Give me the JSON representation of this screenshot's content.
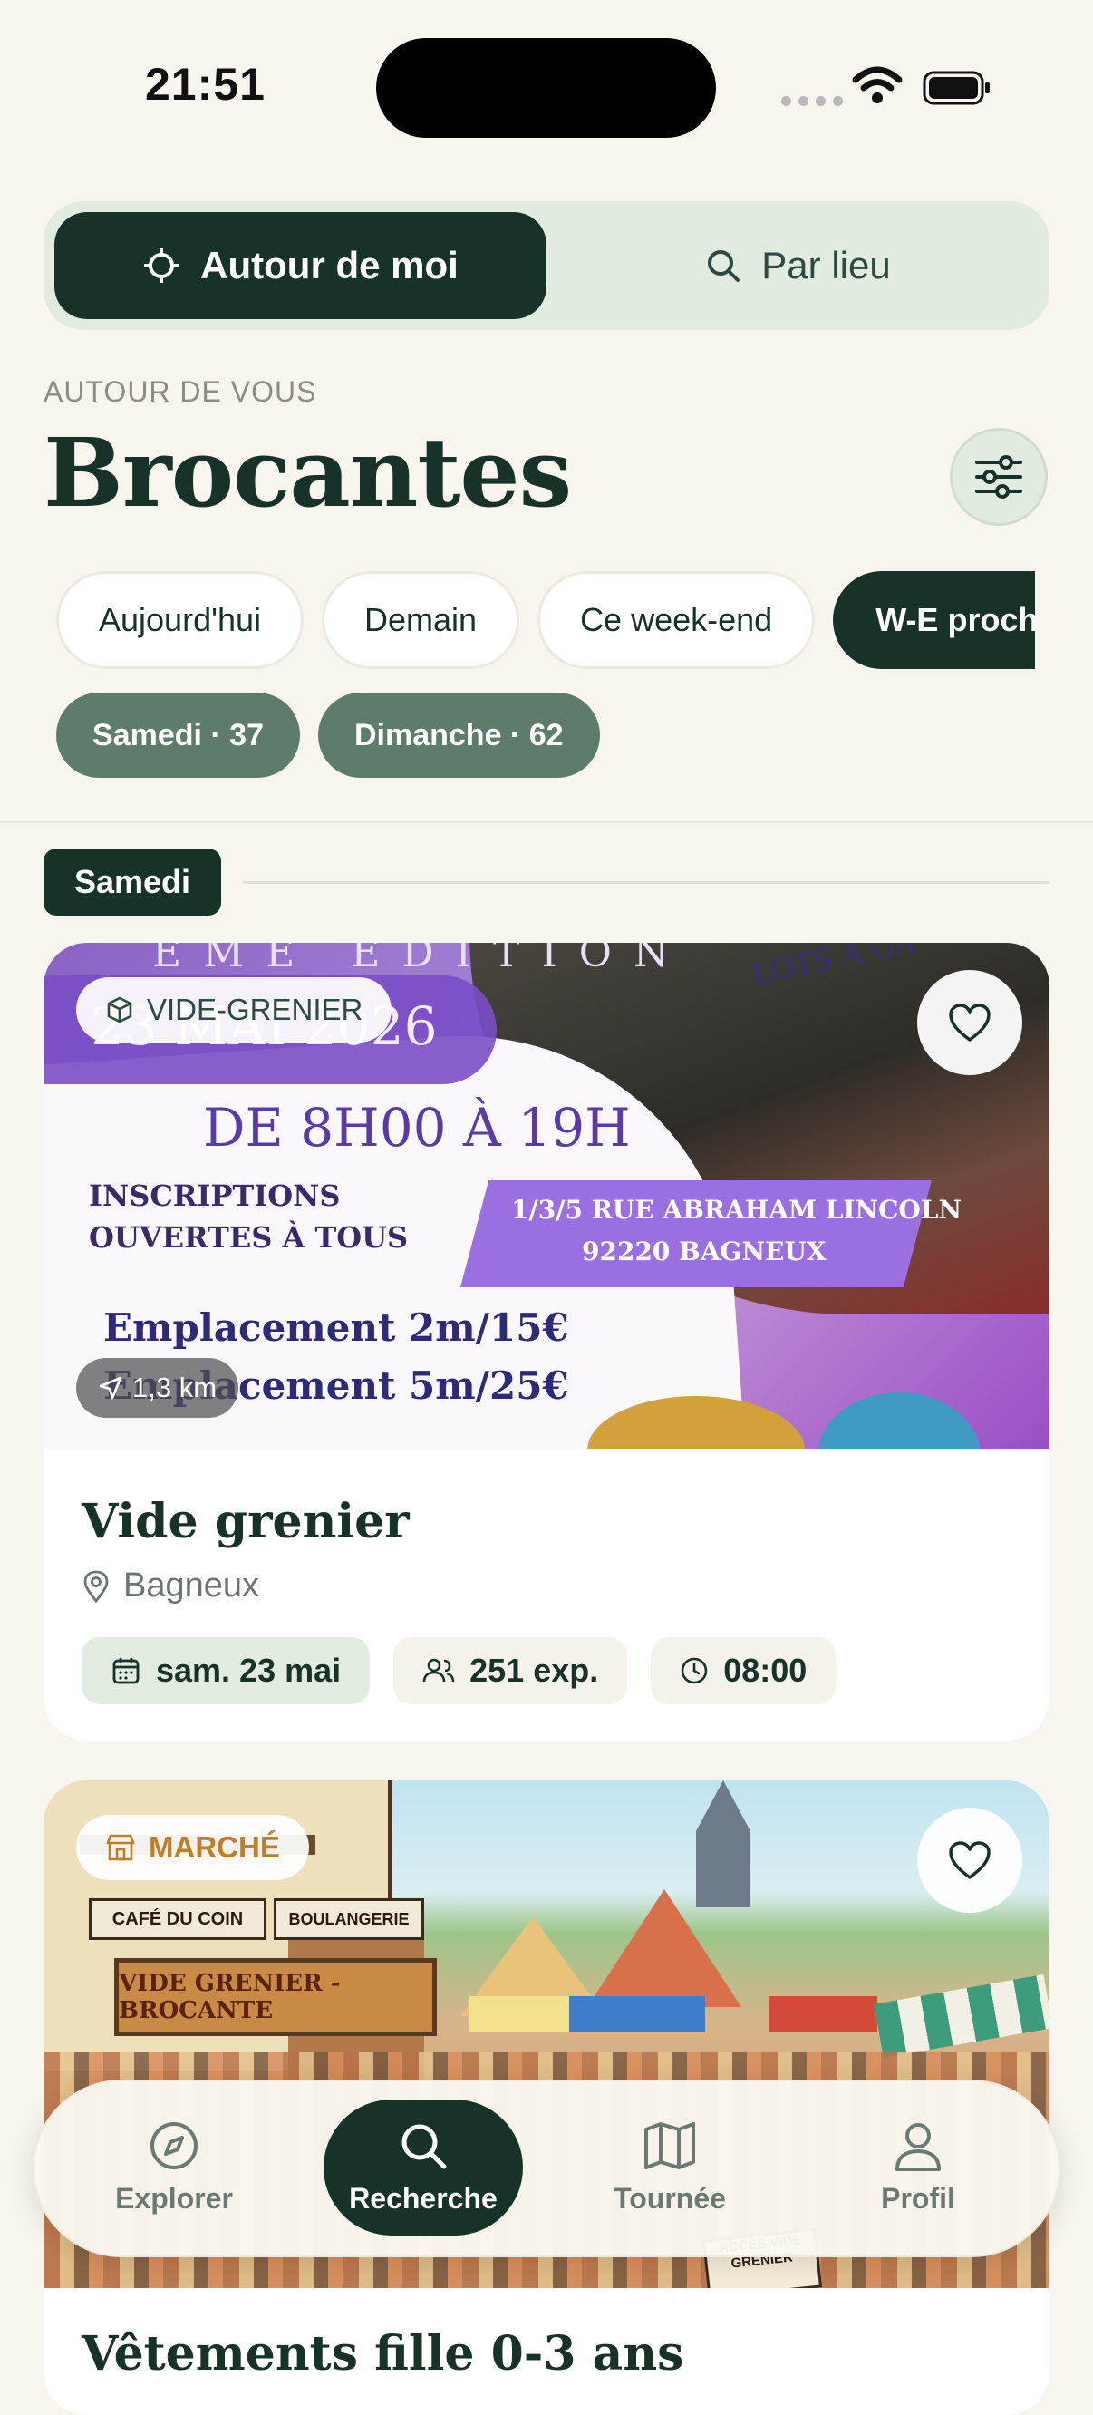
{
  "status_bar": {
    "time": "21:51"
  },
  "segmented": {
    "active_label": "Autour de moi",
    "inactive_label": "Par lieu"
  },
  "header": {
    "eyebrow": "AUTOUR DE VOUS",
    "title": "Brocantes"
  },
  "date_chips": [
    {
      "label": "Aujourd'hui",
      "active": false
    },
    {
      "label": "Demain",
      "active": false
    },
    {
      "label": "Ce week-end",
      "active": false
    },
    {
      "label": "W-E prochain",
      "active": true
    }
  ],
  "day_chips": [
    {
      "label": "Samedi · 37"
    },
    {
      "label": "Dimanche · 62"
    }
  ],
  "section": {
    "label": "Samedi"
  },
  "cards": [
    {
      "badge": "VIDE-GRENIER",
      "badge_icon": "box-icon",
      "distance": "1,3 km",
      "title": "Vide grenier",
      "location": "Bagneux",
      "date": "sam. 23 mai",
      "exhibitors": "251 exp.",
      "time": "08:00",
      "poster": {
        "line_date": "23 MAI 2026",
        "line_top": "ÈME ÉDITION",
        "line_hours": "DE 8H00 À 19H",
        "line_insc1": "INSCRIPTIONS",
        "line_insc2": "OUVERTES À TOUS",
        "line_addr1": "1/3/5 RUE ABRAHAM LINCOLN",
        "line_addr2": "92220 BAGNEUX",
        "line_price1": "Emplacement 2m/15€",
        "line_price2": "Emplacement 5m/25€",
        "line_lots": "LOTS À GA"
      }
    },
    {
      "badge": "MARCHÉ",
      "badge_icon": "store-icon",
      "title": "Vêtements fille 0-3 ans",
      "poster": {
        "sign": "VIDE GRENIER - BROCANTE",
        "cafe": "CAFÉ DU COIN",
        "boulangerie": "BOULANGERIE",
        "small_sign": "ACCÈS VIDE GRENIER"
      }
    }
  ],
  "nav": [
    {
      "label": "Explorer",
      "icon": "compass-icon",
      "active": false
    },
    {
      "label": "Recherche",
      "icon": "search-icon",
      "active": true
    },
    {
      "label": "Tournée",
      "icon": "map-icon",
      "active": false
    },
    {
      "label": "Profil",
      "icon": "user-icon",
      "active": false
    }
  ],
  "colors": {
    "primary": "#173328",
    "background": "#f8f5ef",
    "subchip": "#5d7c6c",
    "accent_light": "#e2ebe0",
    "badge_orange": "#c07f24"
  }
}
